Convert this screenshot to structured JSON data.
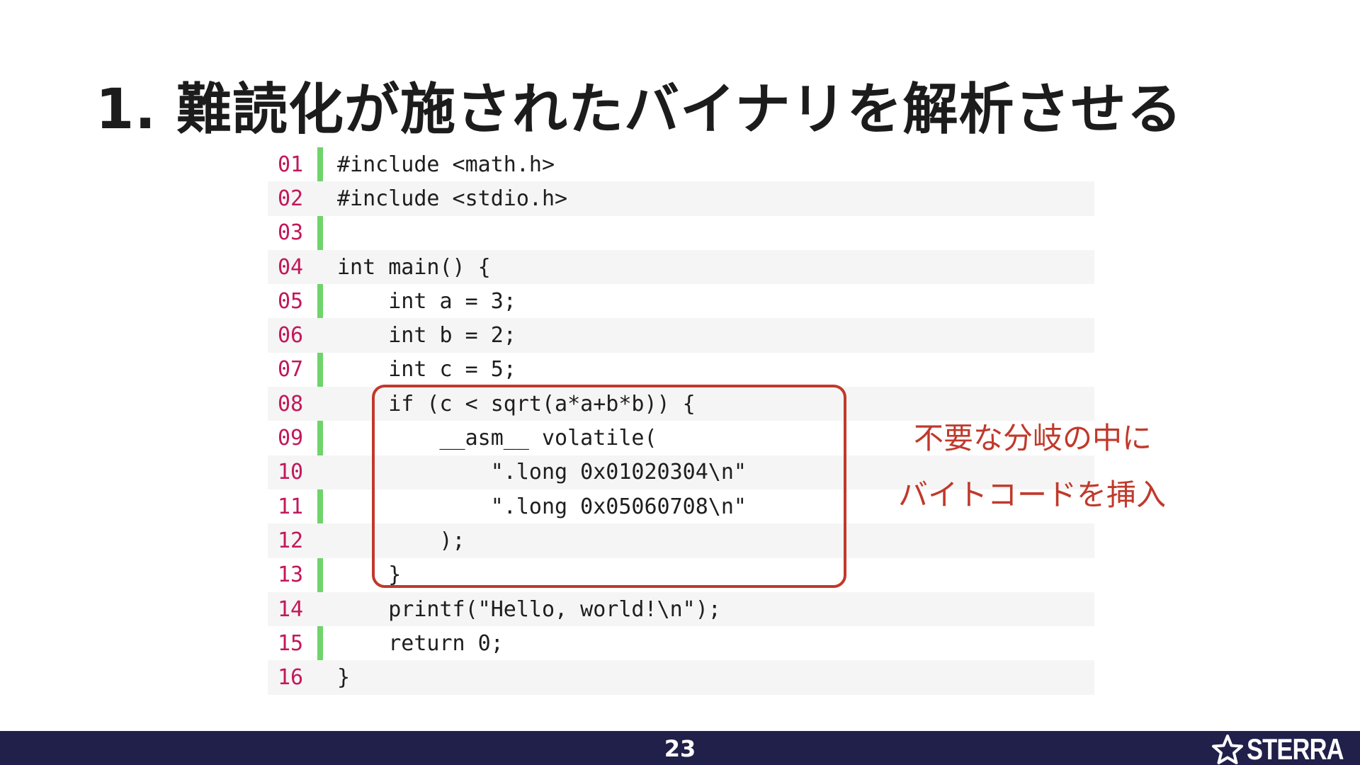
{
  "slide": {
    "title": "1. 難読化が施されたバイナリを解析させる",
    "page_number": "23",
    "logo_text": "STERRA"
  },
  "code": {
    "lines": [
      {
        "num": "01",
        "text": "#include <math.h>"
      },
      {
        "num": "02",
        "text": "#include <stdio.h>"
      },
      {
        "num": "03",
        "text": ""
      },
      {
        "num": "04",
        "text": "int main() {"
      },
      {
        "num": "05",
        "text": "    int a = 3;"
      },
      {
        "num": "06",
        "text": "    int b = 2;"
      },
      {
        "num": "07",
        "text": "    int c = 5;"
      },
      {
        "num": "08",
        "text": "    if (c < sqrt(a*a+b*b)) {"
      },
      {
        "num": "09",
        "text": "        __asm__ volatile("
      },
      {
        "num": "10",
        "text": "            \".long 0x01020304\\n\""
      },
      {
        "num": "11",
        "text": "            \".long 0x05060708\\n\""
      },
      {
        "num": "12",
        "text": "        );"
      },
      {
        "num": "13",
        "text": "    }"
      },
      {
        "num": "14",
        "text": "    printf(\"Hello, world!\\n\");"
      },
      {
        "num": "15",
        "text": "    return 0;"
      },
      {
        "num": "16",
        "text": "}"
      }
    ]
  },
  "annotation": {
    "line1": "不要な分岐の中に",
    "line2": "バイトコードを挿入"
  },
  "colors": {
    "accent": "#c0392b",
    "gutter": "#6fd46b",
    "line_number": "#c2185b",
    "footer": "#20204a"
  },
  "icons": {
    "logo": "star-outline-icon"
  }
}
